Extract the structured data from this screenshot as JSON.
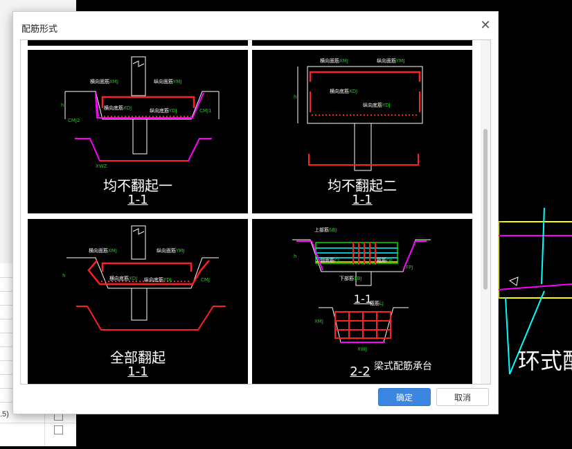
{
  "dialog": {
    "title": "配筋形式",
    "close_symbol": "✕",
    "ok_label": "确定",
    "cancel_label": "取消"
  },
  "options": [
    {
      "title": "均不翻起一",
      "section": "1-1",
      "annotations": [
        "横向面筋XMJ",
        "纵向面筋YMJ",
        "横向底筋XDJ",
        "纵向底筋YDJ",
        "CMJ1",
        "CMJ2",
        "XWZ",
        "h"
      ]
    },
    {
      "title": "均不翻起二",
      "section": "1-1",
      "annotations": [
        "横向面筋XMJ",
        "纵向面筋YMJ",
        "横向底筋XDJ",
        "纵向底筋YDJ",
        "h"
      ]
    },
    {
      "title": "全部翻起",
      "section": "1-1",
      "annotations": [
        "横向面筋XMJ",
        "纵向面筋YMJ",
        "横向底筋XDJ",
        "纵向底筋YDJ",
        "CMJ",
        "h"
      ]
    },
    {
      "title": "梁式配筋承台",
      "sections": [
        "1-1",
        "2-2"
      ],
      "annotations": [
        "上部筋SBJ",
        "侧面筋CJ",
        "箍筋GJ",
        "下部筋XBJ",
        "FPJ",
        "箍筋LJ",
        "XMJ",
        "XWJ",
        "h"
      ]
    }
  ],
  "background": {
    "cad_text": "环式配",
    "sheet_fragment": ".5)"
  },
  "colors": {
    "primary_button": "#3a86e0",
    "rebar_red": "#ff2020",
    "rebar_magenta": "#ff00ff",
    "label_green": "#00e000",
    "cad_yellow": "#ffff00",
    "cad_cyan": "#00ffff"
  }
}
